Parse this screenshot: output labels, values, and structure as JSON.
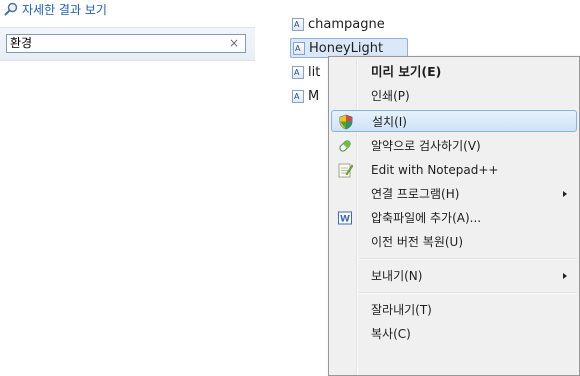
{
  "search": {
    "see_more_label": "자세한 결과 보기",
    "query": "환경",
    "clear_symbol": "×"
  },
  "files": [
    {
      "name": "champagne",
      "selected": false
    },
    {
      "name": "HoneyLight",
      "selected": true
    },
    {
      "name": "lit",
      "selected": false
    },
    {
      "name": "M",
      "selected": false
    }
  ],
  "context_menu": {
    "items": [
      {
        "label": "미리 보기(E)",
        "bold": true,
        "icon": null,
        "submenu": false
      },
      {
        "label": "인쇄(P)",
        "bold": false,
        "icon": null,
        "submenu": false
      },
      {
        "label": "설치(I)",
        "bold": false,
        "icon": "shield-icon",
        "submenu": false,
        "highlighted": true
      },
      {
        "label": "알약으로 검사하기(V)",
        "bold": false,
        "icon": "pill-icon",
        "submenu": false
      },
      {
        "label": "Edit with Notepad++",
        "bold": false,
        "icon": "notepad-icon",
        "submenu": false
      },
      {
        "label": "연결 프로그램(H)",
        "bold": false,
        "icon": null,
        "submenu": true
      },
      {
        "label": "압축파일에 추가(A)...",
        "bold": false,
        "icon": "archive-icon",
        "submenu": false
      },
      {
        "label": "이전 버전 복원(U)",
        "bold": false,
        "icon": null,
        "submenu": false
      },
      {
        "label": "보내기(N)",
        "bold": false,
        "icon": null,
        "submenu": true
      },
      {
        "label": "잘라내기(T)",
        "bold": false,
        "icon": null,
        "submenu": false
      },
      {
        "label": "복사(C)",
        "bold": false,
        "icon": null,
        "submenu": false
      }
    ]
  },
  "colors": {
    "link": "#1f5fa8",
    "selection_fill": "#dbe8f8",
    "selection_border": "#8fb2dc",
    "menu_background": "#f0f0f0",
    "menu_highlight_border": "#86b4e2"
  }
}
